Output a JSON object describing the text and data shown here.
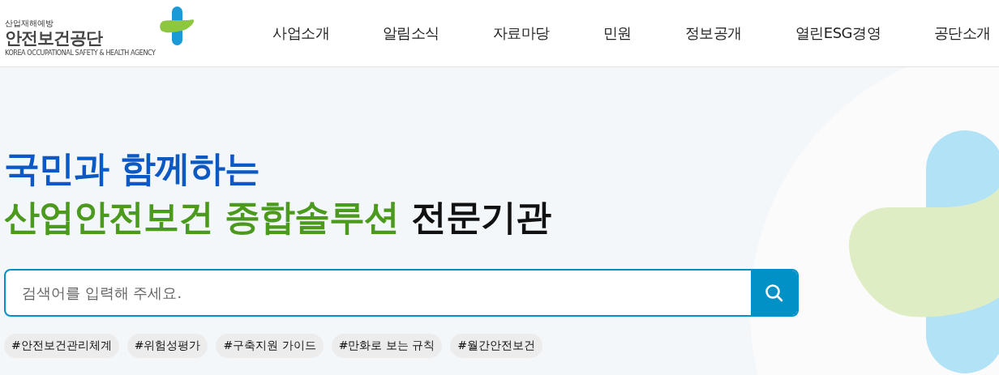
{
  "logo": {
    "tagline": "산업재해예방",
    "name": "안전보건공단",
    "english": "KOREA OCCUPATIONAL SAFETY & HEALTH AGENCY"
  },
  "nav": [
    "사업소개",
    "알림소식",
    "자료마당",
    "민원",
    "정보공개",
    "열린ESG경영",
    "공단소개"
  ],
  "headline": [
    [
      {
        "text": "국민과 함께하는",
        "kind": "primary"
      }
    ],
    [
      {
        "text": "산업안전보건 종합솔루션",
        "kind": "accent"
      },
      {
        "text": " 전문기관",
        "kind": "plain"
      }
    ]
  ],
  "search": {
    "placeholder": "검색어를 입력해 주세요."
  },
  "tags": [
    "#안전보건관리체계",
    "#위험성평가",
    "#구축지원 가이드",
    "#만화로 보는 규칙",
    "#월간안전보건"
  ]
}
